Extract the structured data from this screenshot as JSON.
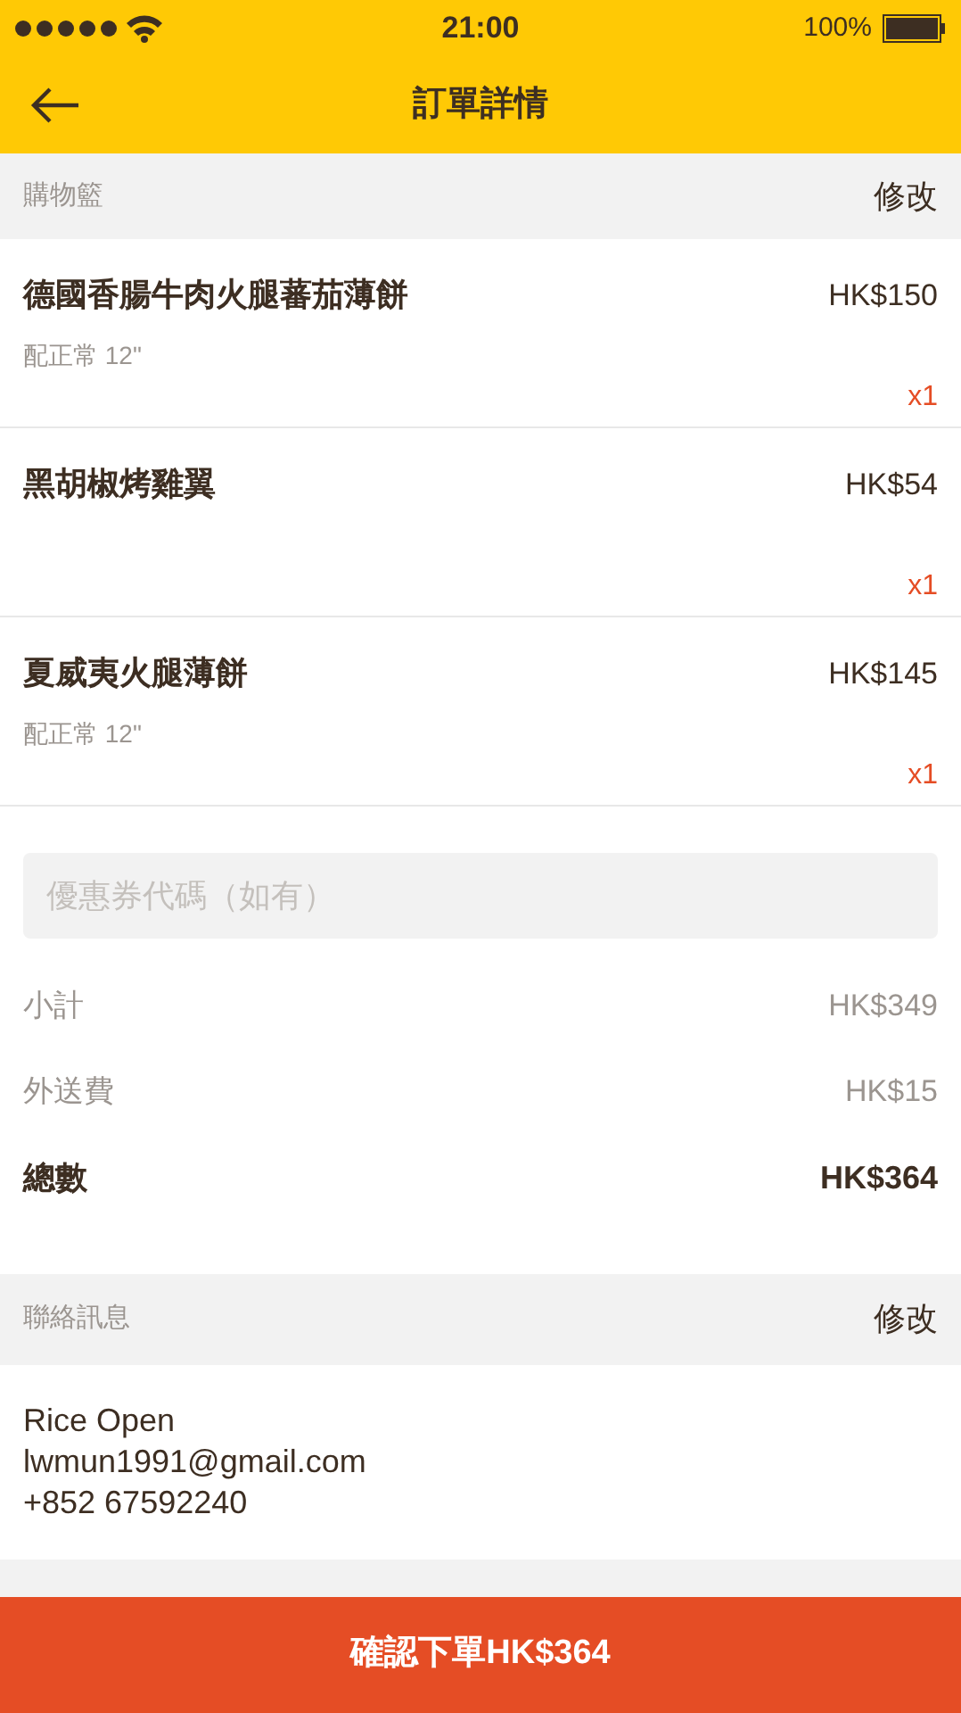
{
  "status_bar": {
    "time": "21:00",
    "battery": "100%"
  },
  "nav": {
    "title": "訂單詳情"
  },
  "cart": {
    "header": "購物籃",
    "edit": "修改",
    "items": [
      {
        "name": "德國香腸牛肉火腿蕃茄薄餅",
        "price": "HK$150",
        "option": "配正常 12\"",
        "quantity": "x1"
      },
      {
        "name": "黑胡椒烤雞翼",
        "price": "HK$54",
        "quantity": "x1"
      },
      {
        "name": "夏威夷火腿薄餅",
        "price": "HK$145",
        "option": "配正常 12\"",
        "quantity": "x1"
      }
    ]
  },
  "coupon": {
    "placeholder": "優惠券代碼（如有）"
  },
  "summary": [
    {
      "label": "小計",
      "value": "HK$349",
      "kind": "normal"
    },
    {
      "label": "外送費",
      "value": "HK$15",
      "kind": "normal"
    },
    {
      "label": "總數",
      "value": "HK$364",
      "kind": "total"
    }
  ],
  "contact": {
    "header": "聯絡訊息",
    "edit": "修改",
    "lines": [
      "Rice Open",
      "lwmun1991@gmail.com",
      "+852 67592240"
    ]
  },
  "confirm_button": "確認下單HK$364"
}
